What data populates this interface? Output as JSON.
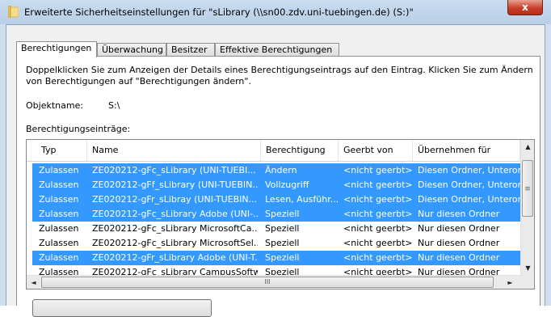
{
  "window": {
    "title": "Erweiterte Sicherheitseinstellungen für \"sLibrary (\\\\sn00.zdv.uni-tuebingen.de) (S:)\"",
    "close_label": "x"
  },
  "tabs": [
    {
      "label": "Berechtigungen",
      "active": true
    },
    {
      "label": "Überwachung"
    },
    {
      "label": "Besitzer"
    },
    {
      "label": "Effektive Berechtigungen"
    }
  ],
  "description": "Doppelklicken Sie zum Anzeigen der Details eines Berechtigungseintrags auf den Eintrag. Klicken Sie zum Ändern von Berechtigungen auf \"Berechtigungen ändern\".",
  "object": {
    "label": "Objektname:",
    "value": "S:\\"
  },
  "entries_label": "Berechtigungseinträge:",
  "table": {
    "columns": [
      "Typ",
      "Name",
      "Berechtigung",
      "Geerbt von",
      "Übernehmen für"
    ],
    "rows": [
      {
        "selected": true,
        "type": "Zulassen",
        "name": "ZE020212-gFc_sLibrary (UNI-TUEBI...",
        "permission": "Ändern",
        "inherited": "<nicht geerbt>",
        "apply": "Diesen Ordner, Unterordr"
      },
      {
        "selected": true,
        "type": "Zulassen",
        "name": "ZE020212-gFf_sLibrary (UNI-TUEBIN...",
        "permission": "Vollzugriff",
        "inherited": "<nicht geerbt>",
        "apply": "Diesen Ordner, Unterordr"
      },
      {
        "selected": true,
        "type": "Zulassen",
        "name": "ZE020212-gFr_sLibray (UNI-TUEBIN...",
        "permission": "Lesen, Ausführ...",
        "inherited": "<nicht geerbt>",
        "apply": "Diesen Ordner, Unterordr"
      },
      {
        "selected": true,
        "type": "Zulassen",
        "name": "ZE020212-gFc_sLibrary Adobe (UNI-...",
        "permission": "Speziell",
        "inherited": "<nicht geerbt>",
        "apply": "Nur diesen Ordner"
      },
      {
        "selected": false,
        "type": "Zulassen",
        "name": "ZE020212-gFc_sLibrary MicrosoftCa...",
        "permission": "Speziell",
        "inherited": "<nicht geerbt>",
        "apply": "Nur diesen Ordner"
      },
      {
        "selected": false,
        "type": "Zulassen",
        "name": "ZE020212-gFc_sLibrary MicrosoftSel...",
        "permission": "Speziell",
        "inherited": "<nicht geerbt>",
        "apply": "Nur diesen Ordner"
      },
      {
        "selected": true,
        "type": "Zulassen",
        "name": "ZE020212-gFr_sLibrary Adobe (UNI-T...",
        "permission": "Speziell",
        "inherited": "<nicht geerbt>",
        "apply": "Nur diesen Ordner"
      },
      {
        "selected": false,
        "type": "Zulassen",
        "name": "ZE020212-gFc_sLibrary CampusSoftw...",
        "permission": "Speziell",
        "inherited": "<nicht geerbt>",
        "apply": "Nur diesen Ordner"
      }
    ]
  },
  "scrollbar": {
    "up": "▲",
    "down": "▼",
    "left": "◄",
    "right": "►",
    "grip": "≡",
    "hgrip": "III"
  },
  "colors": {
    "selection": "#3399ff",
    "titlebar": "#c9dcf0",
    "close": "#c8402c"
  }
}
